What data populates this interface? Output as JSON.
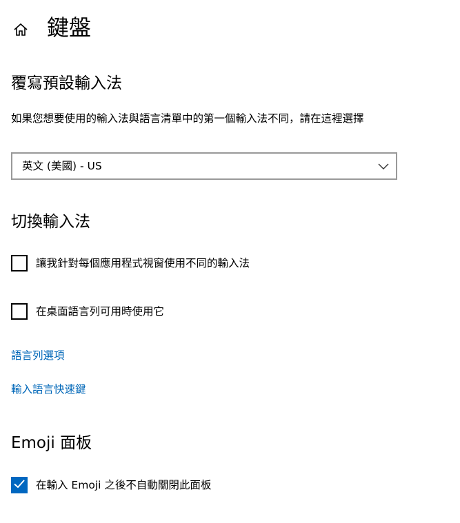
{
  "header": {
    "home_icon": "home-icon",
    "title": "鍵盤"
  },
  "override_section": {
    "heading": "覆寫預設輸入法",
    "description": "如果您想要使用的輸入法與語言清單中的第一個輸入法不同，請在這裡選擇",
    "dropdown": {
      "value": "英文 (美國) - US",
      "chevron_icon": "chevron-down-icon"
    }
  },
  "switch_section": {
    "heading": "切換輸入法",
    "options": [
      {
        "label": "讓我針對每個應用程式視窗使用不同的輸入法",
        "checked": false
      },
      {
        "label": "在桌面語言列可用時使用它",
        "checked": false
      }
    ],
    "links": [
      {
        "label": "語言列選項"
      },
      {
        "label": "輸入語言快速鍵"
      }
    ]
  },
  "emoji_section": {
    "heading": "Emoji 面板",
    "option": {
      "label": "在輸入 Emoji 之後不自動關閉此面板",
      "checked": true
    }
  },
  "colors": {
    "accent": "#0067c0",
    "link": "#0067b8",
    "border": "#999999"
  }
}
